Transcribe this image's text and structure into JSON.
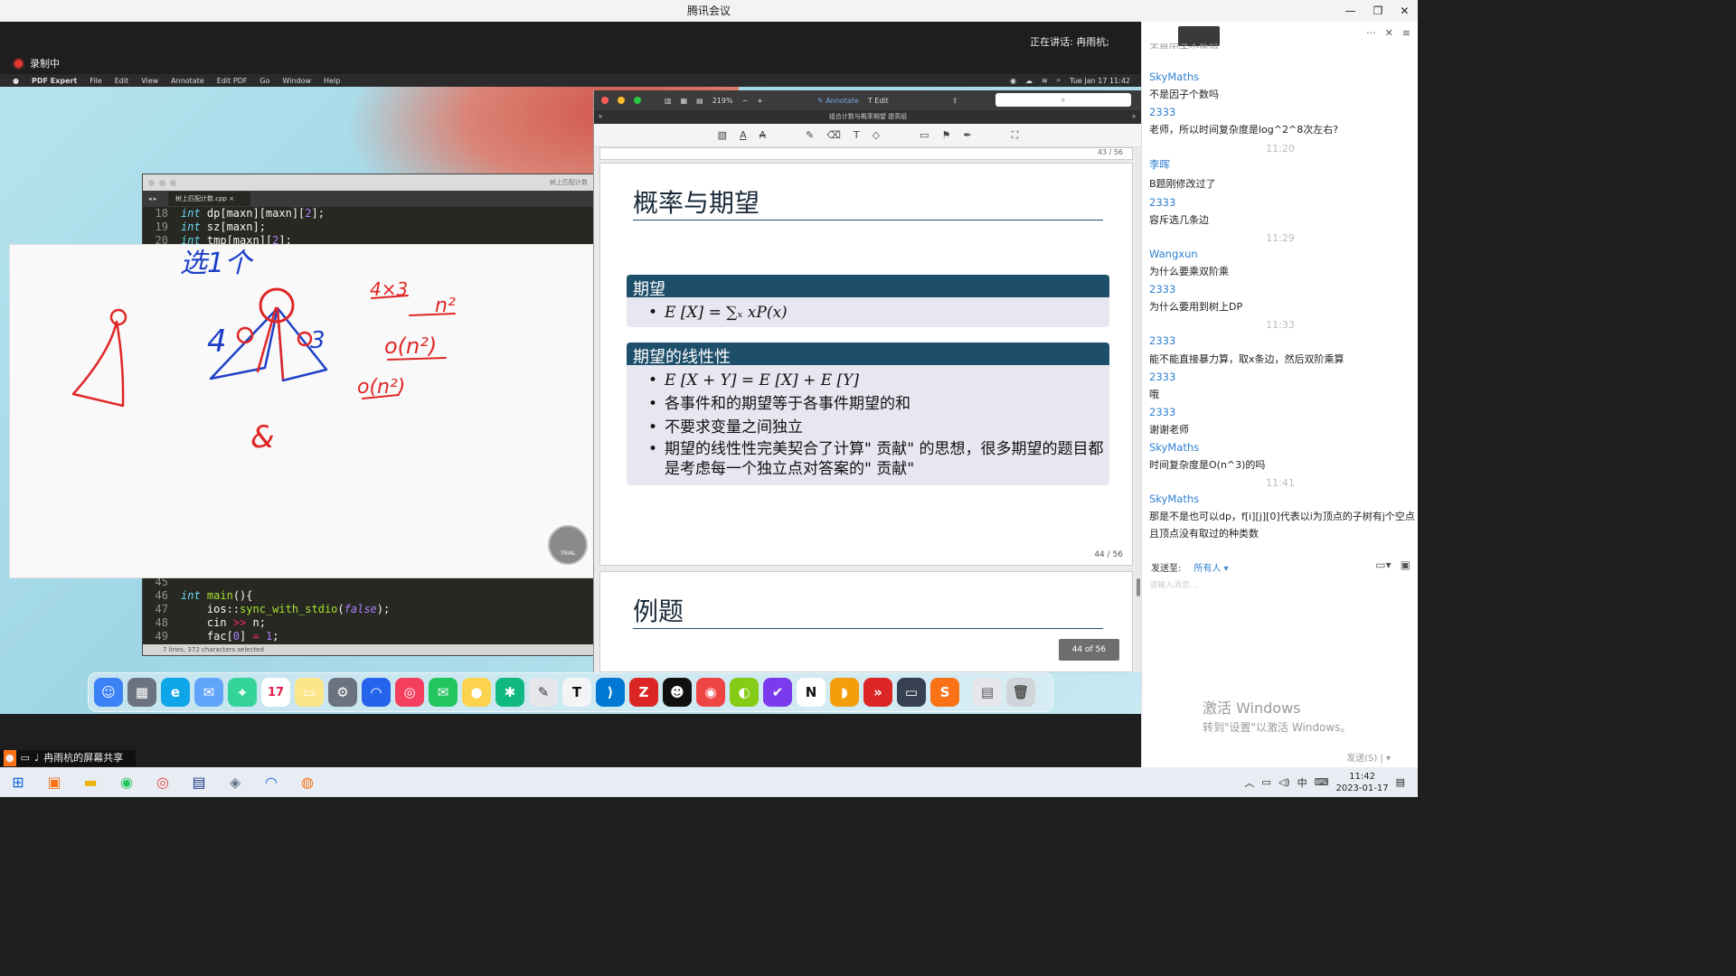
{
  "window": {
    "title": "腾讯会议"
  },
  "meeting": {
    "speaker": "正在讲话: 冉雨杭;",
    "recording": "录制中",
    "share_label": "冉雨杭的屏幕共享"
  },
  "mac": {
    "menu": [
      "PDF Expert",
      "File",
      "Edit",
      "View",
      "Annotate",
      "Edit PDF",
      "Go",
      "Window",
      "Help"
    ],
    "clock": "Tue Jan 17  11:42"
  },
  "editor": {
    "window_title": "树上匹配计数",
    "tab": "树上匹配计数.cpp",
    "status": "7 lines, 372 characters selected",
    "top_lines": [
      {
        "n": "18",
        "code": "int dp[maxn][maxn][2];"
      },
      {
        "n": "19",
        "code": "int sz[maxn];"
      },
      {
        "n": "20",
        "code": "int tmp[maxn][2];"
      }
    ],
    "bottom_lines": [
      {
        "n": "45",
        "code": ""
      },
      {
        "n": "46",
        "code": "int main(){"
      },
      {
        "n": "47",
        "code": "ios::sync_with_stdio(false);"
      },
      {
        "n": "48",
        "code": "cin >> n;"
      },
      {
        "n": "49",
        "code": "fac[0] = 1;"
      }
    ]
  },
  "whiteboard": {
    "badge": "TRIAL",
    "ink": [
      "选1个",
      "4",
      "3",
      "4×3",
      "n²",
      "o(n²)",
      "o(n²)",
      "&"
    ],
    "ink_color_blue": "#1e40c8",
    "ink_color_red": "#e02626"
  },
  "pdf": {
    "zoom": "219%",
    "annotate": "Annotate",
    "edit": "Edit",
    "doc_title": "组合计数与概率期望 提高组",
    "prev_page": "43 / 56",
    "page_label": "44 / 56",
    "page_badge": "44 of 56",
    "slide_title": "概率与期望",
    "block1": {
      "title": "期望",
      "items": [
        "E [X] = ∑ₓ xP(x)"
      ]
    },
    "block2": {
      "title": "期望的线性性",
      "items": [
        "E [X + Y] = E [X] + E [Y]",
        "各事件和的期望等于各事件期望的和",
        "不要求变量之间独立",
        "期望的线性性完美契合了计算\" 贡献\" 的思想，很多期望的题目都是考虑每一个独立点对答案的\" 贡献\""
      ]
    },
    "next_slide_title": "例题"
  },
  "chat": {
    "messages": [
      {
        "kind": "text",
        "text": "不是因子个数吗"
      },
      {
        "kind": "name",
        "text": "SkyMaths"
      },
      {
        "kind": "text",
        "text": "不是因子个数吗"
      },
      {
        "kind": "name",
        "text": "2333"
      },
      {
        "kind": "text",
        "text": "老师，所以时间复杂度是log^2^8次左右?"
      },
      {
        "kind": "time",
        "text": "11:20"
      },
      {
        "kind": "name",
        "text": "李晖"
      },
      {
        "kind": "text",
        "text": "B题刚修改过了"
      },
      {
        "kind": "name",
        "text": "2333"
      },
      {
        "kind": "text",
        "text": "容斥选几条边"
      },
      {
        "kind": "time",
        "text": "11:29"
      },
      {
        "kind": "name",
        "text": "Wangxun"
      },
      {
        "kind": "text",
        "text": "为什么要乘双阶乘"
      },
      {
        "kind": "name",
        "text": "2333"
      },
      {
        "kind": "text",
        "text": "为什么要用到树上DP"
      },
      {
        "kind": "time",
        "text": "11:33"
      },
      {
        "kind": "name",
        "text": "2333"
      },
      {
        "kind": "text",
        "text": "能不能直接暴力算，取x条边，然后双阶乘算"
      },
      {
        "kind": "name",
        "text": "2333"
      },
      {
        "kind": "text",
        "text": "哦"
      },
      {
        "kind": "name",
        "text": "2333"
      },
      {
        "kind": "text",
        "text": "谢谢老师"
      },
      {
        "kind": "name",
        "text": "SkyMaths"
      },
      {
        "kind": "text",
        "text": "时间复杂度是O(n^3)的吗"
      },
      {
        "kind": "time",
        "text": "11:41"
      },
      {
        "kind": "name",
        "text": "SkyMaths"
      },
      {
        "kind": "text",
        "text": "那是不是也可以dp，f[i][j][0]代表以i为顶点的子树有j个空点且顶点没有取过的种类数"
      }
    ],
    "send_to_label": "发送至:",
    "send_to_value": "所有人",
    "input_placeholder": "请输入消息...",
    "send_button": "发送(S)"
  },
  "activation": {
    "line1": "激活 Windows",
    "line2": "转到\"设置\"以激活 Windows。"
  },
  "taskbar": {
    "time": "11:42",
    "date": "2023-01-17",
    "ime": "中"
  }
}
